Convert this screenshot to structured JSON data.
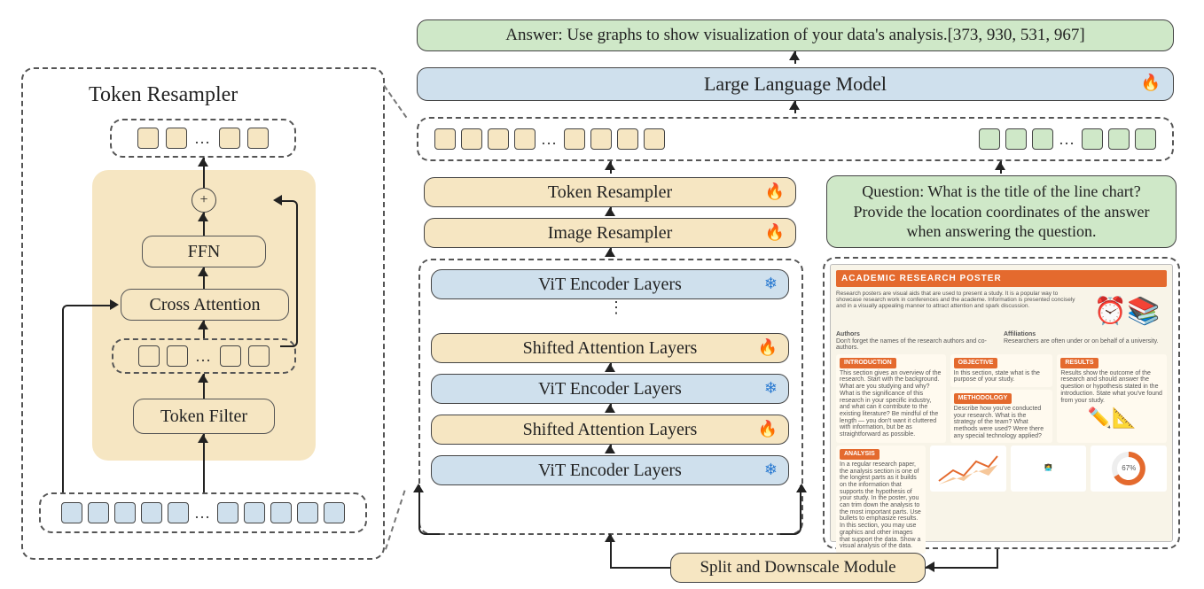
{
  "answer_block": "Answer: Use graphs to show visualization of your data's analysis.[373, 930, 531, 967]",
  "llm_block": "Large Language Model",
  "encoder_stack": {
    "token_resampler": "Token Resampler",
    "image_resampler": "Image Resampler",
    "layers": [
      "ViT Encoder Layers",
      "Shifted Attention Layers",
      "ViT Encoder Layers",
      "Shifted Attention Layers",
      "ViT Encoder Layers"
    ]
  },
  "question_block": "Question: What is the title of the line chart? Provide the location coordinates of the answer when answering the question.",
  "split_module": "Split and Downscale Module",
  "left_panel": {
    "title": "Token Resampler",
    "ffn": "FFN",
    "cross_attention": "Cross Attention",
    "token_filter": "Token Filter",
    "plus": "+"
  },
  "poster": {
    "title": "ACADEMIC RESEARCH POSTER",
    "subtitle": "Research posters are visual aids that are used to present a study. It is a popular way to showcase research work in conferences and the academe. Information is presented concisely and in a visually appealing manner to attract attention and spark discussion.",
    "authors_h": "Authors",
    "authors_t": "Don't forget the names of the research authors and co-authors.",
    "affil_h": "Affiliations",
    "affil_t": "Researchers are often under or on behalf of a university.",
    "intro_h": "INTRODUCTION",
    "intro_t": "This section gives an overview of the research. Start with the background. What are you studying and why? What is the significance of this research in your specific industry, and what can it contribute to the existing literature? Be mindful of the length — you don't want it cluttered with information, but be as straightforward as possible.",
    "obj_h": "OBJECTIVE",
    "obj_t": "In this section, state what is the purpose of your study.",
    "meth_h": "METHODOLOGY",
    "meth_t": "Describe how you've conducted your research. What is the strategy of the team? What methods were used? Were there any special technology applied?",
    "res_h": "RESULTS",
    "res_t": "Results show the outcome of the research and should answer the question or hypothesis stated in the introduction. State what you've found from your study.",
    "ana_h": "ANALYSIS",
    "ana_t": "In a regular research paper, the analysis section is one of the longest parts as it builds on the information that supports the hypothesis of your study. In the poster, you can trim down the analysis to the most important parts. Use bullets to emphasize results. In this section, you may use graphics and other images that support the data. Show a visual analysis of the data.",
    "pct": "67%"
  }
}
